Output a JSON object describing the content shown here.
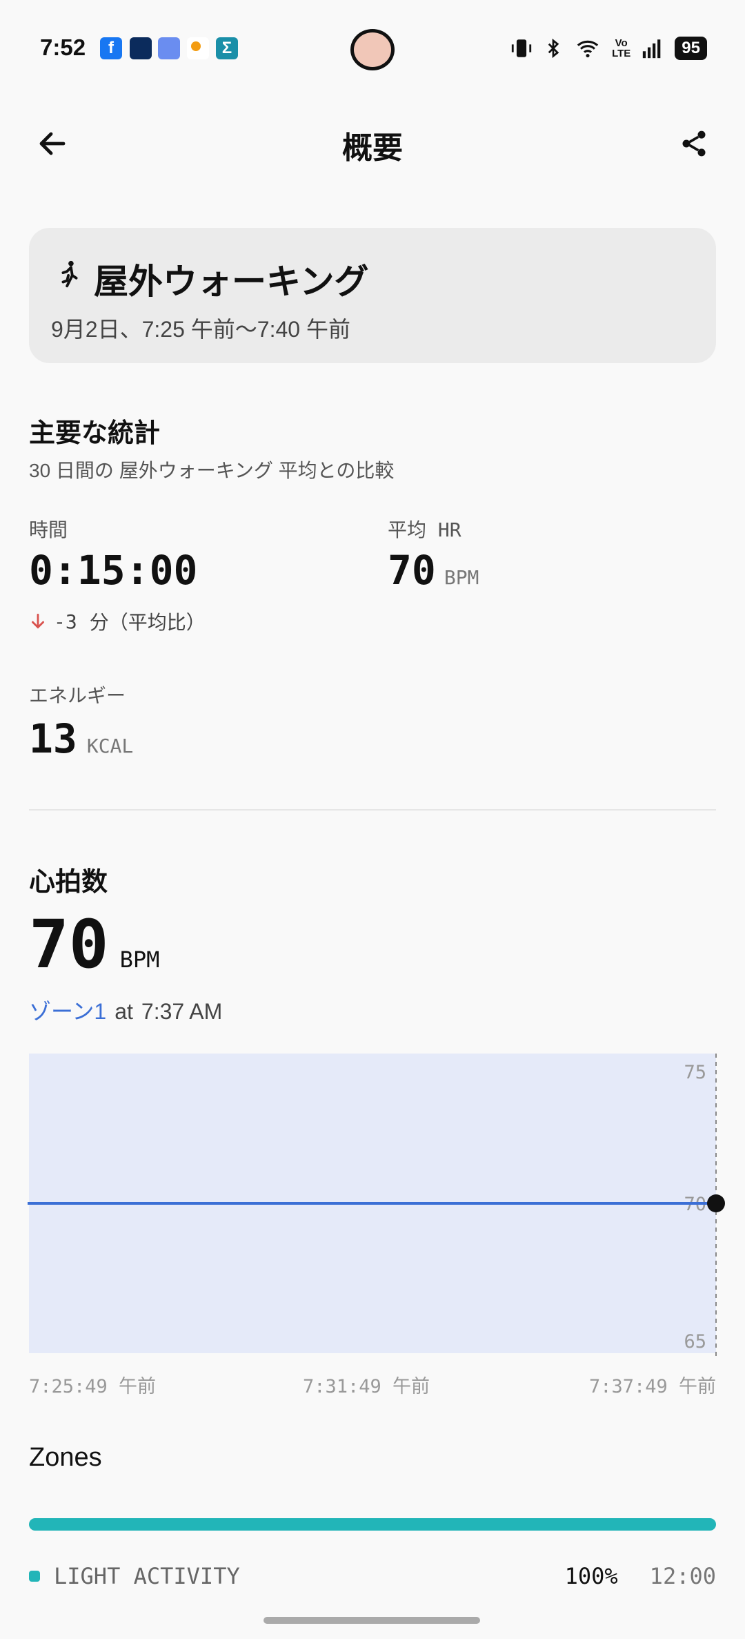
{
  "status_bar": {
    "time": "7:52",
    "battery": "95",
    "notification_icons": [
      "facebook-icon",
      "nikkei-icon",
      "app-icon",
      "weather-icon",
      "sigma-icon"
    ],
    "right_icons": [
      "vibrate-icon",
      "bluetooth-icon",
      "wifi-icon",
      "volte-icon",
      "signal-icon"
    ]
  },
  "header": {
    "title": "概要"
  },
  "activity": {
    "name": "屋外ウォーキング",
    "time_range": "9月2日、7:25 午前〜7:40 午前"
  },
  "key_stats": {
    "title": "主要な統計",
    "subtitle": "30 日間の 屋外ウォーキング 平均との比較",
    "duration_label": "時間",
    "duration_value": "0:15:00",
    "duration_delta": "-3",
    "duration_delta_text": "分（平均比）",
    "avg_hr_label": "平均 HR",
    "avg_hr_value": "70",
    "avg_hr_unit": "BPM",
    "energy_label": "エネルギー",
    "energy_value": "13",
    "energy_unit": "KCAL"
  },
  "heart_rate": {
    "title": "心拍数",
    "value": "70",
    "unit": "BPM",
    "zone_label": "ゾーン1",
    "at_text": "at",
    "time": "7:37 AM"
  },
  "chart_data": {
    "type": "line",
    "series": [
      {
        "values": [
          70,
          70,
          70,
          70
        ]
      }
    ],
    "x": [
      "7:25:49 午前",
      "7:31:49 午前",
      "7:37:49 午前"
    ],
    "y_ticks": [
      "75",
      "70",
      "65"
    ],
    "ylim": [
      65,
      75
    ],
    "line_color": "#3b6fd6",
    "area_color": "#e5eaf9"
  },
  "zones": {
    "title": "Zones",
    "items": [
      {
        "name": "LIGHT ACTIVITY",
        "percent": "100%",
        "duration": "12:00",
        "color": "#22b5b8"
      }
    ]
  },
  "colors": {
    "accent_blue": "#3b6fd6",
    "delta_red": "#d9534f",
    "zone_teal": "#22b5b8"
  }
}
